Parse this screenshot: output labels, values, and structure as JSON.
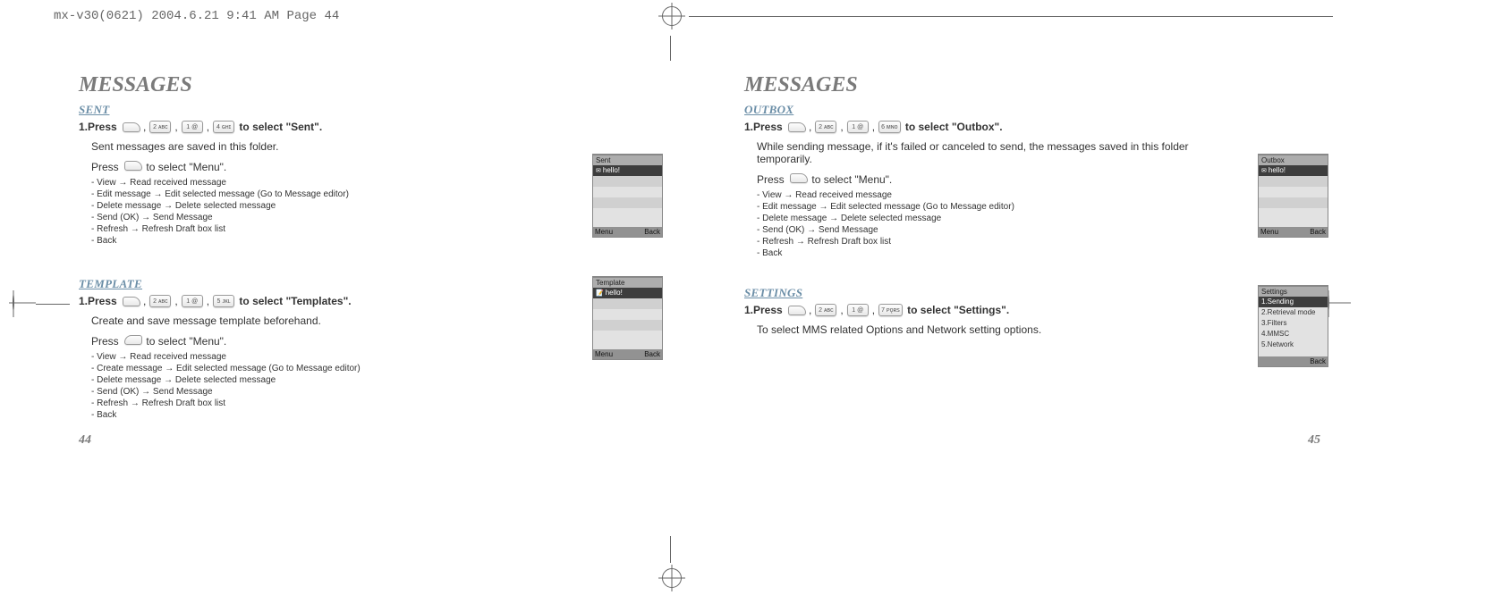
{
  "crop_marks": "mx-v30(0621)  2004.6.21  9:41 AM  Page 44",
  "left": {
    "title": "MESSAGES",
    "sections": {
      "sent": {
        "heading": "SENT",
        "step_prefix": "1.Press",
        "keys": [
          "2 ᴀʙᴄ",
          "1 @",
          "4 ɢʜɪ"
        ],
        "step_suffix": "to select \"Sent\".",
        "desc": "Sent messages are saved in this folder.",
        "press_soft": "Press",
        "press_soft_tail": "to select \"Menu\".",
        "menu": [
          "- View → Read received message",
          "- Edit message → Edit selected message (Go to Message editor)",
          "- Delete message → Delete selected message",
          "- Send (OK) → Send Message",
          "- Refresh → Refresh Draft box list",
          "- Back"
        ],
        "screen": {
          "title": "Sent",
          "row": "hello!",
          "footer_left": "Menu",
          "footer_right": "Back"
        }
      },
      "template": {
        "heading": "TEMPLATE",
        "step_prefix": "1.Press",
        "keys": [
          "2 ᴀʙᴄ",
          "1 @",
          "5 ᴊᴋʟ"
        ],
        "step_suffix": "to select \"Templates\".",
        "desc": "Create and save message template beforehand.",
        "press_soft": "Press",
        "press_soft_tail": "to select \"Menu\".",
        "menu": [
          "- View → Read received message",
          "- Create message → Edit selected message (Go to Message editor)",
          "- Delete message → Delete selected message",
          "- Send (OK) → Send Message",
          "- Refresh → Refresh Draft box list",
          "- Back"
        ],
        "screen": {
          "title": "Template",
          "row": "hello!",
          "footer_left": "Menu",
          "footer_right": "Back"
        }
      }
    },
    "page_no": "44"
  },
  "right": {
    "title": "MESSAGES",
    "sections": {
      "outbox": {
        "heading": "OUTBOX",
        "step_prefix": "1.Press",
        "keys": [
          "2 ᴀʙᴄ",
          "1 @",
          "6 ᴍɴᴏ"
        ],
        "step_suffix": "to select \"Outbox\".",
        "desc": "While sending message, if it's failed or canceled to send, the messages saved in this folder temporarily.",
        "press_soft": "Press",
        "press_soft_tail": "to select \"Menu\".",
        "menu": [
          "- View → Read received message",
          "- Edit message → Edit selected message (Go to Message editor)",
          "- Delete message → Delete selected message",
          "- Send (OK) → Send Message",
          "- Refresh → Refresh Draft box list",
          "- Back"
        ],
        "screen": {
          "title": "Outbox",
          "row": "hello!",
          "footer_left": "Menu",
          "footer_right": "Back"
        }
      },
      "settings": {
        "heading": "SETTINGS",
        "step_prefix": "1.Press",
        "keys": [
          "2 ᴀʙᴄ",
          "1 @",
          "7 ᴘǫʀs"
        ],
        "step_suffix": "to select \"Settings\".",
        "desc": "To select MMS related Options and Network setting options.",
        "screen": {
          "title": "Settings",
          "rows": [
            "1.Sending",
            "2.Retrieval mode",
            "3.Filters",
            "4.MMSC",
            "5.Network"
          ],
          "footer_right": "Back"
        }
      }
    },
    "page_no": "45"
  }
}
